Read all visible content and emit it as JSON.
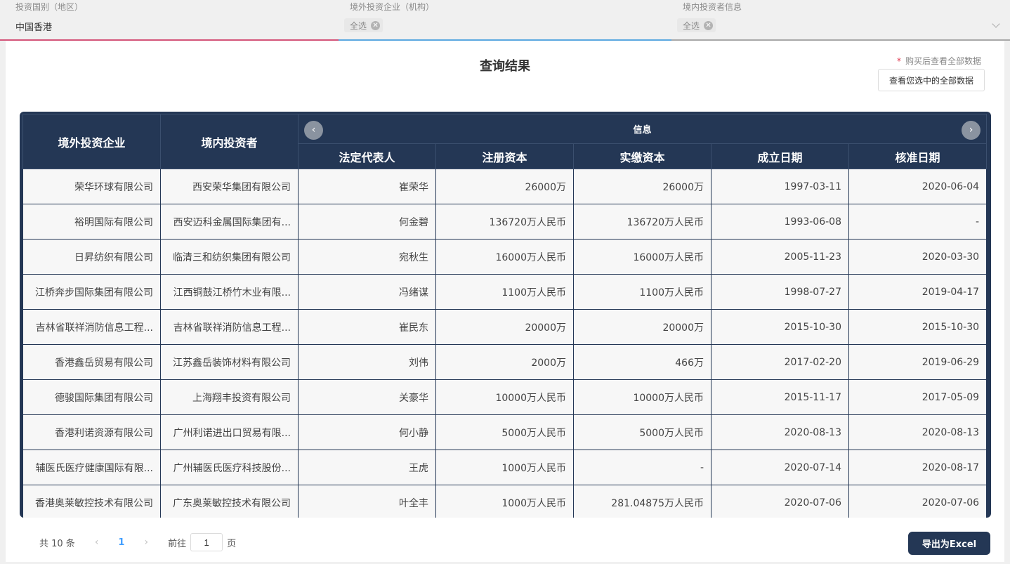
{
  "filters": [
    {
      "label": "投资国别（地区）",
      "value": "中国香港"
    },
    {
      "label": "境外投资企业（机构）",
      "chip": "全选"
    },
    {
      "label": "境内投资者信息",
      "chip": "全选"
    }
  ],
  "result_title": "查询结果",
  "buy_note": "购买后查看全部数据",
  "buy_note_star": "*",
  "view_all_button": "查看您选中的全部数据",
  "table": {
    "headers": {
      "overseas": "境外投资企业",
      "domestic": "境内投资者",
      "info_group": "信息",
      "legal_rep": "法定代表人",
      "reg_capital": "注册资本",
      "paid_capital": "实缴资本",
      "founded": "成立日期",
      "approved": "核准日期"
    },
    "rows": [
      [
        "荣华环球有限公司",
        "西安荣华集团有限公司",
        "崔荣华",
        "26000万",
        "26000万",
        "1997-03-11",
        "2020-06-04"
      ],
      [
        "裕明国际有限公司",
        "西安迈科金属国际集团有...",
        "何金碧",
        "136720万人民币",
        "136720万人民币",
        "1993-06-08",
        "-"
      ],
      [
        "日昇纺织有限公司",
        "临清三和纺织集团有限公司",
        "宛秋生",
        "16000万人民币",
        "16000万人民币",
        "2005-11-23",
        "2020-03-30"
      ],
      [
        "江桥奔步国际集团有限公司",
        "江西铜鼓江桥竹木业有限...",
        "冯绪谋",
        "1100万人民币",
        "1100万人民币",
        "1998-07-27",
        "2019-04-17"
      ],
      [
        "吉林省联祥消防信息工程...",
        "吉林省联祥消防信息工程...",
        "崔民东",
        "20000万",
        "20000万",
        "2015-10-30",
        "2015-10-30"
      ],
      [
        "香港鑫岳贸易有限公司",
        "江苏鑫岳装饰材料有限公司",
        "刘伟",
        "2000万",
        "466万",
        "2017-02-20",
        "2019-06-29"
      ],
      [
        "德骏国际集团有限公司",
        "上海翔丰投资有限公司",
        "关豪华",
        "10000万人民币",
        "10000万人民币",
        "2015-11-17",
        "2017-05-09"
      ],
      [
        "香港利诺资源有限公司",
        "广州利诺进出口贸易有限...",
        "何小静",
        "5000万人民币",
        "5000万人民币",
        "2020-08-13",
        "2020-08-13"
      ],
      [
        "辅医氏医疗健康国际有限...",
        "广州辅医氏医疗科技股份...",
        "王虎",
        "1000万人民币",
        "-",
        "2020-07-14",
        "2020-08-17"
      ],
      [
        "香港奥莱敏控技术有限公司",
        "广东奥莱敏控技术有限公司",
        "叶全丰",
        "1000万人民币",
        "281.04875万人民币",
        "2020-07-06",
        "2020-07-06"
      ]
    ]
  },
  "pagination": {
    "total": "共 10 条",
    "prev": "‹",
    "page": "1",
    "next": "›",
    "goto_prefix": "前往",
    "goto_value": "1",
    "goto_suffix": "页"
  },
  "export_button": "导出为Excel",
  "colors": {
    "accent": "#243755",
    "filter1": "#d4557a",
    "filter2": "#5ba8e0",
    "page_active": "#409eff"
  }
}
